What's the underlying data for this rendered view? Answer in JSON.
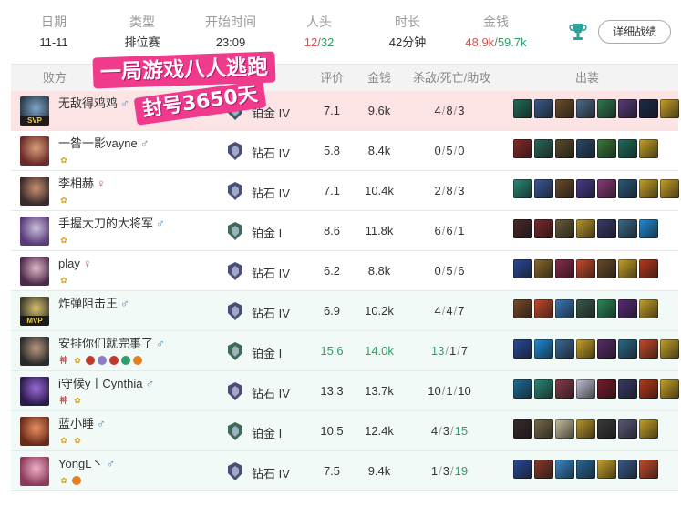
{
  "summary": {
    "date": {
      "label": "日期",
      "value": "11-11"
    },
    "type": {
      "label": "类型",
      "value": "排位赛"
    },
    "start": {
      "label": "开始时间",
      "value": "23:09"
    },
    "kills": {
      "label": "人头",
      "value_a": "12",
      "value_b": "32"
    },
    "duration": {
      "label": "时长",
      "value": "42分钟"
    },
    "gold": {
      "label": "金钱",
      "value_a": "48.9k",
      "value_b": "59.7k"
    },
    "detail_button": "详细战绩"
  },
  "table_header": {
    "result": "败方",
    "score": "评价",
    "gold": "金钱",
    "kda": "杀敌/死亡/助攻",
    "items": "出装"
  },
  "banner": {
    "line1": "一局游戏八人逃跑",
    "line2": "封号3650天"
  },
  "colors": {
    "lose_accent": "#d9534f",
    "win_accent": "#2e9e6a",
    "highlight_row": "#fde4e4",
    "win_row": "#f2faf7",
    "banner_pink": "#f03a8c"
  },
  "players": [
    {
      "name": "无敌得鸡鸡",
      "gender": "♂",
      "badge": "SVP",
      "rank": "铂金 IV",
      "score": "7.1",
      "gold": "9.6k",
      "k": "4",
      "d": "8",
      "a": "3",
      "team": "hl",
      "tags": [],
      "avatar": [
        "#2a3a4a",
        "#7fa6c8"
      ],
      "rank_color": "#3e5a6a",
      "items": [
        "#1f6e5a",
        "#3a5c8c",
        "#6b4f2a",
        "#4b6b8a",
        "#2f7a4f",
        "#5a3b7a",
        "#1d2b4a",
        "#c9a227"
      ]
    },
    {
      "name": "一咎一影vayne",
      "gender": "♂",
      "badge": "",
      "rank": "钻石 IV",
      "score": "5.8",
      "gold": "8.4k",
      "k": "0",
      "d": "5",
      "a": "0",
      "team": "loss",
      "tags": [
        "hu"
      ],
      "avatar": [
        "#6b2a2a",
        "#d8a07a"
      ],
      "rank_color": "#4a4f7a",
      "items": [
        "#8a2a2a",
        "#2a6a5a",
        "#5a4a2a",
        "#2a4a6a",
        "#3a7a3a",
        "#1f6e5a",
        "#c9a227"
      ]
    },
    {
      "name": "李相赫",
      "gender": "♀",
      "badge": "",
      "rank": "钻石 IV",
      "score": "7.1",
      "gold": "10.4k",
      "k": "2",
      "d": "8",
      "a": "3",
      "team": "loss",
      "tags": [
        "hu"
      ],
      "avatar": [
        "#3a2a2a",
        "#c89070"
      ],
      "rank_color": "#4a4f7a",
      "items": [
        "#2a8a7a",
        "#3a5a9a",
        "#6a4a2a",
        "#4a3a8a",
        "#8a3a7a",
        "#2a5a7a",
        "#c9a227",
        "#c9a227"
      ]
    },
    {
      "name": "手握大刀的大将军",
      "gender": "♂",
      "badge": "",
      "rank": "铂金 I",
      "score": "8.6",
      "gold": "11.8k",
      "k": "6",
      "d": "6",
      "a": "1",
      "team": "loss",
      "tags": [
        "hu"
      ],
      "avatar": [
        "#5a3a7a",
        "#c8c0d8"
      ],
      "rank_color": "#3e6a5a",
      "items": [
        "#4a2a2a",
        "#7a2a2a",
        "#6a5a3a",
        "#b8962a",
        "#3a3a6a",
        "#3a6a8a",
        "#1e8ed8"
      ]
    },
    {
      "name": "play",
      "gender": "♀",
      "badge": "",
      "rank": "钻石 IV",
      "score": "6.2",
      "gold": "8.8k",
      "k": "0",
      "d": "5",
      "a": "6",
      "team": "loss",
      "tags": [
        "hu"
      ],
      "avatar": [
        "#4a2a4a",
        "#e0b8c8"
      ],
      "rank_color": "#4a4f7a",
      "items": [
        "#2a4a9a",
        "#8a6a2a",
        "#8a2a4a",
        "#c84a2a",
        "#6a4a2a",
        "#c9a227",
        "#b83a1a"
      ]
    },
    {
      "name": "炸弹阻击王",
      "gender": "♂",
      "badge": "MVP",
      "rank": "钻石 IV",
      "score": "6.9",
      "gold": "10.2k",
      "k": "4",
      "d": "4",
      "a": "7",
      "team": "win",
      "tags": [],
      "avatar": [
        "#3a3a2a",
        "#d8c070"
      ],
      "rank_color": "#4a4f7a",
      "items": [
        "#7a4a2a",
        "#c84a2a",
        "#3a7aba",
        "#3a5a4a",
        "#2a8a5a",
        "#5a2a7a",
        "#c9a227"
      ]
    },
    {
      "name": "安排你们就完事了",
      "gender": "♂",
      "badge": "",
      "rank": "铂金 I",
      "score": "15.6",
      "gold": "14.0k",
      "k": "13",
      "d": "1",
      "a": "7",
      "team": "win",
      "tags": [
        "shen",
        "hu",
        "dot1",
        "dot2",
        "dot3",
        "dot4",
        "dot5"
      ],
      "highlight": true,
      "avatar": [
        "#2a2a2a",
        "#b89880"
      ],
      "rank_color": "#3e6a5a",
      "items": [
        "#2a4a9a",
        "#1e8ed8",
        "#3a6a9a",
        "#c9a227",
        "#5a2a6a",
        "#2a6a8a",
        "#c84a2a",
        "#c9a227"
      ]
    },
    {
      "name": "i守候y丨Cynthia",
      "gender": "♂",
      "badge": "",
      "rank": "钻石 IV",
      "score": "13.3",
      "gold": "13.7k",
      "k": "10",
      "d": "1",
      "a": "10",
      "team": "win",
      "tags": [
        "shen",
        "hu"
      ],
      "avatar": [
        "#2a1a4a",
        "#9a6ad8"
      ],
      "rank_color": "#4a4f7a",
      "items": [
        "#1f6e9a",
        "#2a8a7a",
        "#8a3a4a",
        "#c0c0d8",
        "#7a1a2a",
        "#3a3a6a",
        "#b83a1a",
        "#c9a227"
      ]
    },
    {
      "name": "蓝小睡",
      "gender": "♂",
      "badge": "",
      "rank": "铂金 I",
      "score": "10.5",
      "gold": "12.4k",
      "k": "4",
      "d": "3",
      "a": "15",
      "team": "win",
      "tags": [
        "hu",
        "hu2"
      ],
      "avatar": [
        "#6a2a1a",
        "#e89060"
      ],
      "rank_color": "#3e6a5a",
      "items": [
        "#3a2a2a",
        "#7a6a4a",
        "#c8c0a0",
        "#b8962a",
        "#3a3a3a",
        "#5a5a7a",
        "#c9a227"
      ]
    },
    {
      "name": "YongL丶",
      "gender": "♂",
      "badge": "",
      "rank": "钻石 IV",
      "score": "7.5",
      "gold": "9.4k",
      "k": "1",
      "d": "3",
      "a": "19",
      "team": "win",
      "tags": [
        "hu",
        "dotorange"
      ],
      "avatar": [
        "#8a3a5a",
        "#f0b0c8"
      ],
      "rank_color": "#4a4f7a",
      "items": [
        "#2a4a9a",
        "#8a3a2a",
        "#3a8aca",
        "#2a6a9a",
        "#c9a227",
        "#3a5a8a",
        "#c84a2a"
      ]
    }
  ]
}
